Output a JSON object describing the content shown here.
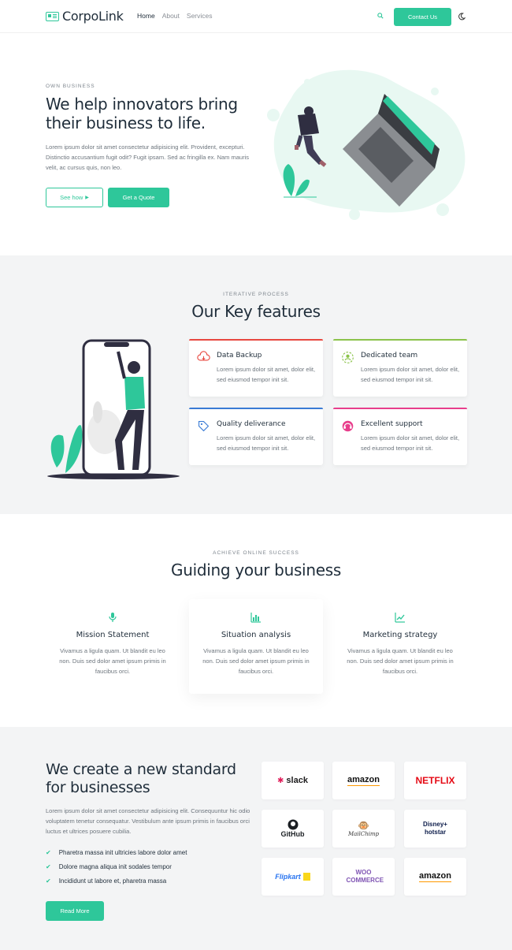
{
  "header": {
    "logo_text": "CorpoLink",
    "nav": [
      "Home",
      "About",
      "Services"
    ],
    "contact_label": "Contact Us"
  },
  "hero": {
    "eyebrow": "OWN BUSINESS",
    "title": "We help innovators bring their business to life.",
    "text": "Lorem ipsum dolor sit amet consectetur adipisicing elit. Provident, excepturi. Distinctio accusantium fugit odit? Fugit ipsam. Sed ac fringilla ex. Nam mauris velit, ac cursus quis, non leo.",
    "see_how_label": "See how",
    "quote_label": "Get a Quote"
  },
  "features": {
    "eyebrow": "ITERATIVE PROCESS",
    "title": "Our Key features",
    "cards": [
      {
        "title": "Data Backup",
        "text": "Lorem ipsum dolor sit amet, dolor elit, sed eiusmod tempor init sit.",
        "color": "#e8473f"
      },
      {
        "title": "Dedicated team",
        "text": "Lorem ipsum dolor sit amet, dolor elit, sed eiusmod tempor init sit.",
        "color": "#8bc34a"
      },
      {
        "title": "Quality deliverance",
        "text": "Lorem ipsum dolor sit amet, dolor elit, sed eiusmod tempor init sit.",
        "color": "#3a7bd5"
      },
      {
        "title": "Excellent support",
        "text": "Lorem ipsum dolor sit amet, dolor elit, sed eiusmod tempor init sit.",
        "color": "#e83e8c"
      }
    ]
  },
  "guide": {
    "eyebrow": "ACHIEVE ONLINE SUCCESS",
    "title": "Guiding your business",
    "items": [
      {
        "title": "Mission Statement",
        "text": "Vivamus a ligula quam. Ut blandit eu leo non. Duis sed dolor amet ipsum primis in faucibus orci."
      },
      {
        "title": "Situation analysis",
        "text": "Vivamus a ligula quam. Ut blandit eu leo non. Duis sed dolor amet ipsum primis in faucibus orci."
      },
      {
        "title": "Marketing strategy",
        "text": "Vivamus a ligula quam. Ut blandit eu leo non. Duis sed dolor amet ipsum primis in faucibus orci."
      }
    ]
  },
  "standard": {
    "title": "We create a new standard for businesses",
    "text": "Lorem ipsum dolor sit amet consectetur adipisicing elit. Consequuntur hic odio voluptatem tenetur consequatur. Vestibulum ante ipsum primis in faucibus orci luctus et ultrices posuere cubilia.",
    "list": [
      "Pharetra massa init ultricies labore dolor amet",
      "Dolore magna aliqua init sodales tempor",
      "Incididunt ut labore et, pharetra massa"
    ],
    "read_more_label": "Read More",
    "logos": [
      "slack",
      "amazon",
      "NETFLIX",
      "GitHub",
      "MailChimp",
      "Disney+ hotstar",
      "Flipkart",
      "WOO COMMERCE",
      "amazon"
    ]
  },
  "colors": {
    "accent": "#2ec79a"
  }
}
